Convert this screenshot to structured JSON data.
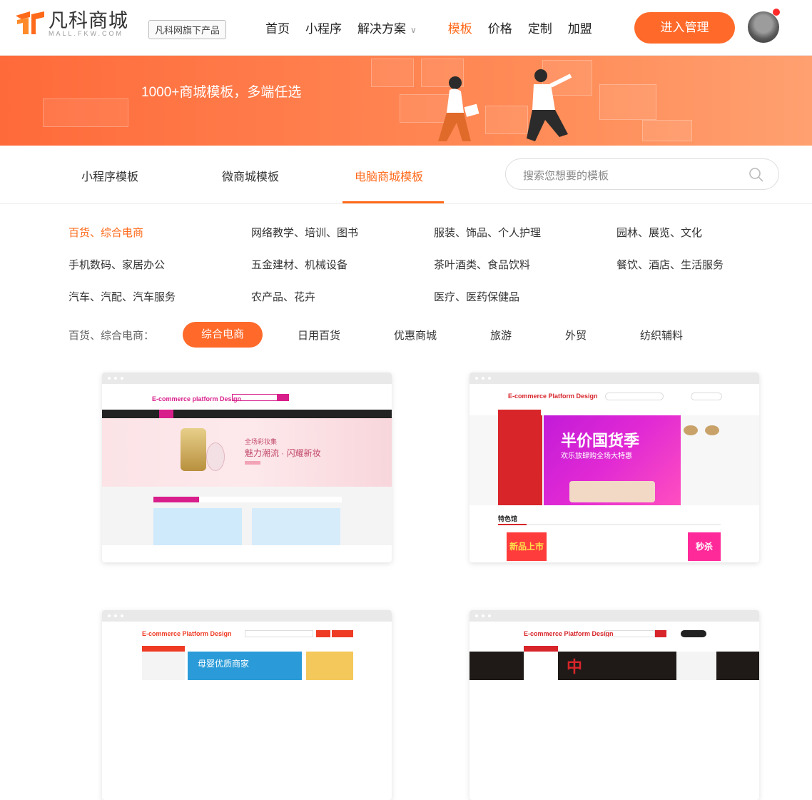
{
  "header": {
    "logo_cn": "凡科商城",
    "logo_en": "MALL.FKW.COM",
    "badge": "凡科网旗下产品",
    "nav": [
      "首页",
      "小程序",
      "解决方案",
      "模板",
      "价格",
      "定制",
      "加盟"
    ],
    "nav_active": "模板",
    "enter_button": "进入管理"
  },
  "banner": {
    "title": "1000+商城模板，多端任选"
  },
  "tabs": {
    "items": [
      "小程序模板",
      "微商城模板",
      "电脑商城模板"
    ],
    "active": "电脑商城模板"
  },
  "search": {
    "placeholder": "搜索您想要的模板"
  },
  "categories": [
    [
      "百货、综合电商",
      "网络教学、培训、图书",
      "服装、饰品、个人护理",
      "园林、展览、文化"
    ],
    [
      "手机数码、家居办公",
      "五金建材、机械设备",
      "茶叶酒类、食品饮料",
      "餐饮、酒店、生活服务"
    ],
    [
      "汽车、汽配、汽车服务",
      "农产品、花卉",
      "医疗、医药保健品"
    ]
  ],
  "subfilter": {
    "label": "百货、综合电商：",
    "items": [
      "综合电商",
      "日用百货",
      "优惠商城",
      "旅游",
      "外贸",
      "纺织辅料"
    ],
    "active": "综合电商"
  },
  "templates": [
    {
      "logo": "E-commerce platform Design",
      "promo": "魅力潮流 · 闪耀新妆",
      "promo_small": "全场彩妆集"
    },
    {
      "logo": "E-commerce Platform Design",
      "promo": "半价国货季",
      "promo_small": "欢乐放肆购全场大特惠",
      "section": "特色馆",
      "tag1": "新品上市",
      "tag2": "秒杀"
    },
    {
      "logo": "E-commerce Platform Design",
      "promo": "母婴优质商家"
    },
    {
      "logo": "E-commerce Platform Design",
      "promo": "中"
    }
  ],
  "colors": {
    "accent": "#ff6a1a",
    "banner": "#ff7a45"
  }
}
